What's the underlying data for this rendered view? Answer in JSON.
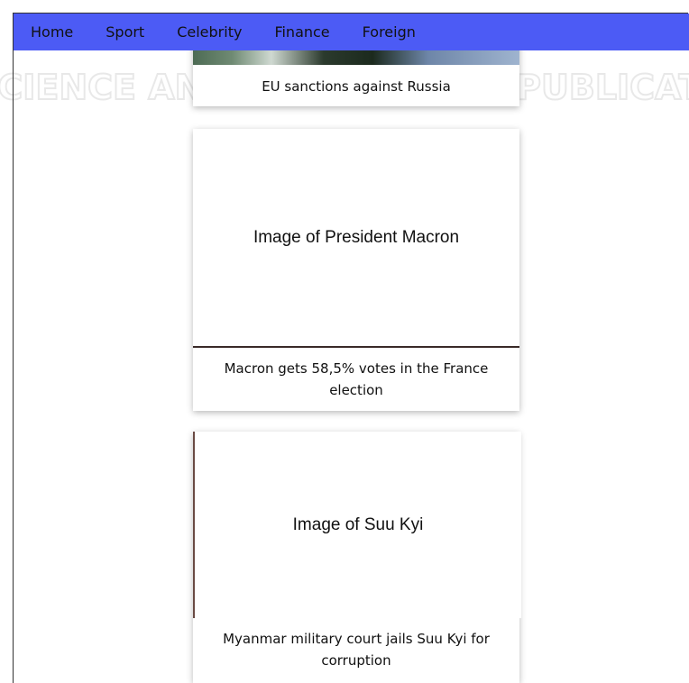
{
  "nav": {
    "items": [
      {
        "label": "Home"
      },
      {
        "label": "Sport"
      },
      {
        "label": "Celebrity"
      },
      {
        "label": "Finance"
      },
      {
        "label": "Foreign"
      }
    ],
    "background": "#4c5bf5"
  },
  "watermark": {
    "text": "SCIENCE AND TECHNOLOGY PUBLICATIONS"
  },
  "cards": [
    {
      "image_alt": "",
      "caption": "EU sanctions against Russia"
    },
    {
      "image_alt": "Image of President Macron",
      "caption": "Macron gets 58,5% votes in the France election"
    },
    {
      "image_alt": "Image of Suu Kyi",
      "caption": "Myanmar military court jails Suu Kyi for corruption"
    }
  ]
}
